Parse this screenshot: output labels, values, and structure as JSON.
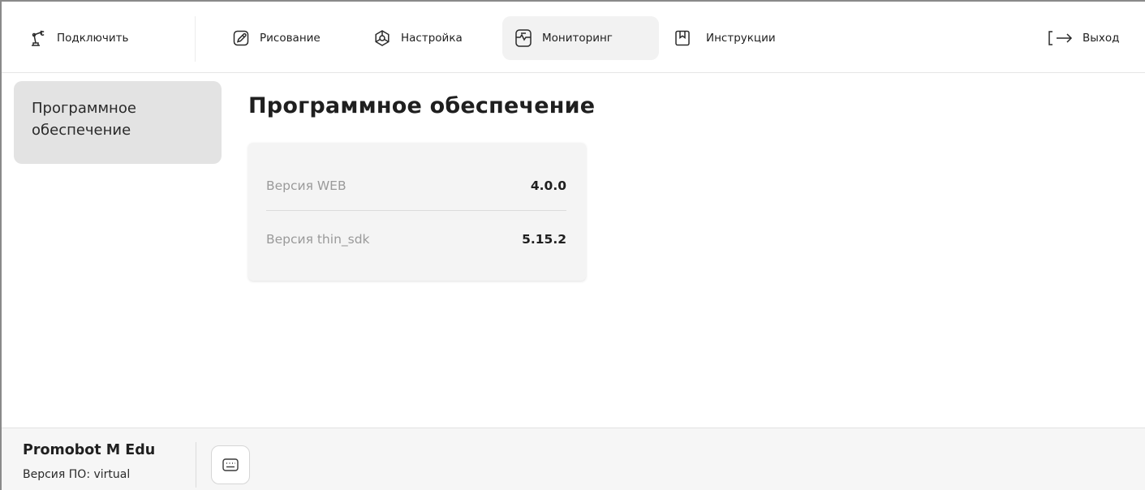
{
  "nav": {
    "connect": {
      "label": "Подключить",
      "icon": "robot-arm-icon"
    },
    "drawing": {
      "label": "Рисование",
      "icon": "pencil-icon"
    },
    "settings": {
      "label": "Настройка",
      "icon": "gear-icon"
    },
    "monitoring": {
      "label": "Мониторинг",
      "icon": "monitor-waveform-icon",
      "active": true
    },
    "instructions": {
      "label": "Инструкции",
      "icon": "bookmark-icon"
    },
    "logout": {
      "label": "Выход",
      "icon": "logout-arrow-icon"
    }
  },
  "sidebar": {
    "items": [
      {
        "label": "Программное обеспечение",
        "selected": true
      }
    ]
  },
  "main": {
    "title": "Программное обеспечение",
    "rows": [
      {
        "key": "Версия WEB",
        "value": "4.0.0"
      },
      {
        "key": "Версия thin_sdk",
        "value": "5.15.2"
      }
    ]
  },
  "footer": {
    "robot_name": "Promobot M Edu",
    "software_version": "Версия ПО: virtual",
    "keyboard_icon": "keyboard-icon"
  },
  "colors": {
    "active_tab_bg": "#f2f2f2",
    "sidebar_selected_bg": "#e3e3e3",
    "card_bg": "#f4f4f4",
    "muted_text": "#9a9a9a"
  }
}
